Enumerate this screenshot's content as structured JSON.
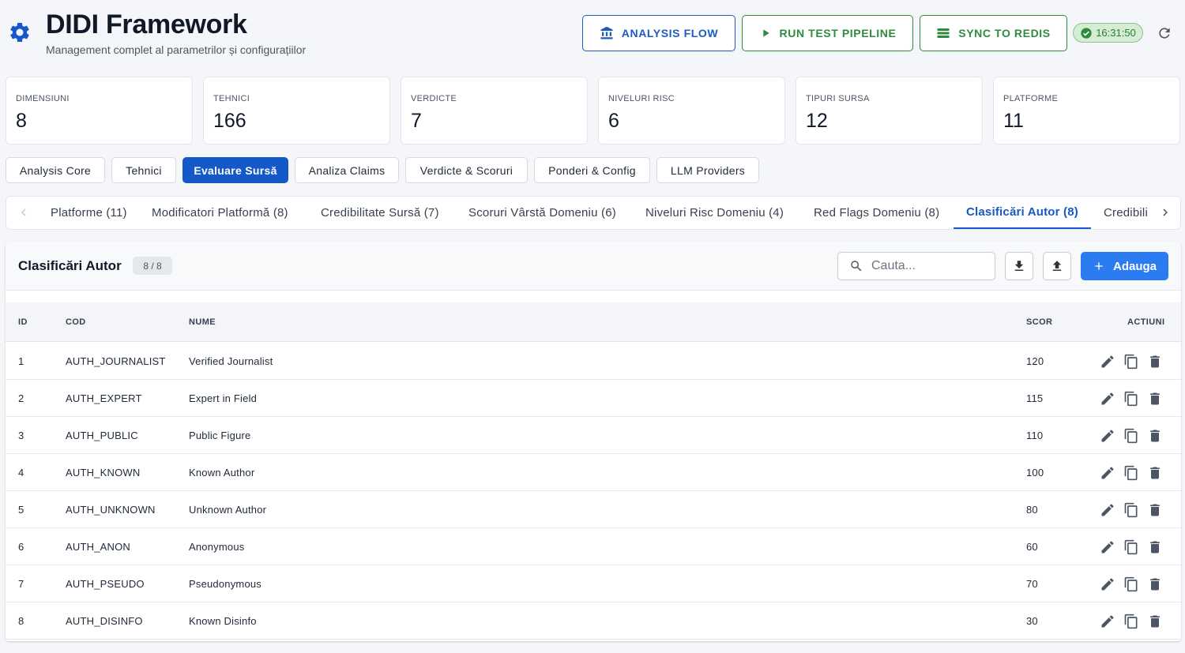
{
  "header": {
    "title": "DIDI Framework",
    "subtitle": "Management complet al parametrilor și configurațiilor",
    "buttons": {
      "analysis_flow": "ANALYSIS FLOW",
      "run_test_pipeline": "RUN TEST PIPELINE",
      "sync_to_redis": "SYNC TO REDIS"
    },
    "time": "16:31:50"
  },
  "stats": [
    {
      "label": "DIMENSIUNI",
      "value": "8"
    },
    {
      "label": "TEHNICI",
      "value": "166"
    },
    {
      "label": "VERDICTE",
      "value": "7"
    },
    {
      "label": "NIVELURI RISC",
      "value": "6"
    },
    {
      "label": "TIPURI SURSA",
      "value": "12"
    },
    {
      "label": "PLATFORME",
      "value": "11"
    }
  ],
  "main_tabs": [
    {
      "label": "Analysis Core"
    },
    {
      "label": "Tehnici"
    },
    {
      "label": "Evaluare Sursă"
    },
    {
      "label": "Analiza Claims"
    },
    {
      "label": "Verdicte & Scoruri"
    },
    {
      "label": "Ponderi & Config"
    },
    {
      "label": "LLM Providers"
    }
  ],
  "active_main_tab": "Evaluare Sursă",
  "sub_tabs": [
    {
      "label": "Platforme (11)"
    },
    {
      "label": "Modificatori Platformă (8)"
    },
    {
      "label": "Credibilitate Sursă (7)"
    },
    {
      "label": "Scoruri Vârstă Domeniu (6)"
    },
    {
      "label": "Niveluri Risc Domeniu (4)"
    },
    {
      "label": "Red Flags Domeniu (8)"
    },
    {
      "label": "Clasificări Autor (8)"
    },
    {
      "label": "Credibili"
    }
  ],
  "active_sub_tab": "Clasificări Autor (8)",
  "panel": {
    "title": "Clasificări Autor",
    "count": "8 / 8",
    "search_placeholder": "Cauta...",
    "add_label": "Adauga"
  },
  "table": {
    "columns": {
      "id": "ID",
      "cod": "COD",
      "nume": "NUME",
      "scor": "SCOR",
      "actiuni": "ACTIUNI"
    },
    "rows": [
      {
        "id": "1",
        "cod": "AUTH_JOURNALIST",
        "nume": "Verified Journalist",
        "scor": "120"
      },
      {
        "id": "2",
        "cod": "AUTH_EXPERT",
        "nume": "Expert in Field",
        "scor": "115"
      },
      {
        "id": "3",
        "cod": "AUTH_PUBLIC",
        "nume": "Public Figure",
        "scor": "110"
      },
      {
        "id": "4",
        "cod": "AUTH_KNOWN",
        "nume": "Known Author",
        "scor": "100"
      },
      {
        "id": "5",
        "cod": "AUTH_UNKNOWN",
        "nume": "Unknown Author",
        "scor": "80"
      },
      {
        "id": "6",
        "cod": "AUTH_ANON",
        "nume": "Anonymous",
        "scor": "60"
      },
      {
        "id": "7",
        "cod": "AUTH_PSEUDO",
        "nume": "Pseudonymous",
        "scor": "70"
      },
      {
        "id": "8",
        "cod": "AUTH_DISINFO",
        "nume": "Known Disinfo",
        "scor": "30"
      }
    ]
  },
  "colors": {
    "primary": "#1558c7",
    "add_button": "#2b7cf0",
    "success": "#2e8b3e",
    "time_badge_bg": "#d5ecd5"
  },
  "icons": {
    "logo": "gear-icon",
    "analysis_flow": "bank-icon",
    "run_test": "play-icon",
    "sync": "list-icon",
    "time": "check-circle-icon",
    "refresh": "refresh-icon",
    "search": "search-icon",
    "export": "download-icon",
    "import": "upload-icon",
    "add": "plus-icon",
    "row_actions": [
      "edit-icon",
      "copy-icon",
      "delete-icon"
    ]
  }
}
